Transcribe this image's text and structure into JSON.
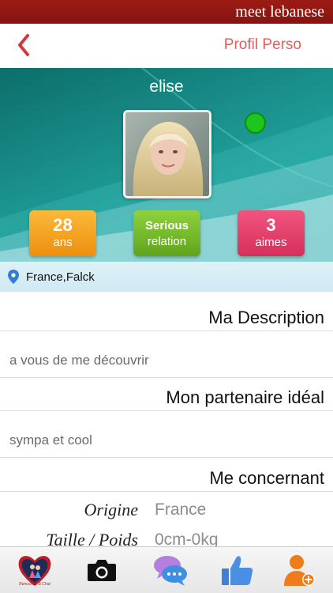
{
  "app": {
    "brand": "meet lebanese"
  },
  "nav": {
    "title": "Profil Perso"
  },
  "profile": {
    "username": "elise",
    "online_color": "#1ec51e",
    "stats": {
      "age_value": "28",
      "age_label": "ans",
      "relation_line1": "Serious",
      "relation_line2": "relation",
      "likes_value": "3",
      "likes_label": "aimes"
    },
    "location": "France,Falck"
  },
  "sections": {
    "description_title": "Ma Description",
    "description_text": "a vous de me découvrir",
    "partner_title": "Mon partenaire idéal",
    "partner_text": "sympa et cool",
    "about_title": "Me concernant"
  },
  "details": {
    "origin_label": "Origine",
    "origin_value": "France",
    "size_label": "Taille / Poids",
    "size_value": "0cm-0kg"
  },
  "tabs": {
    "logo_caption": "Rencontre & Chat"
  },
  "colors": {
    "topbar": "#8e1712",
    "accent_red": "#dd5f5f",
    "stat_orange": "#f4a324",
    "stat_green": "#74bb2c",
    "stat_pink": "#e4416d"
  }
}
